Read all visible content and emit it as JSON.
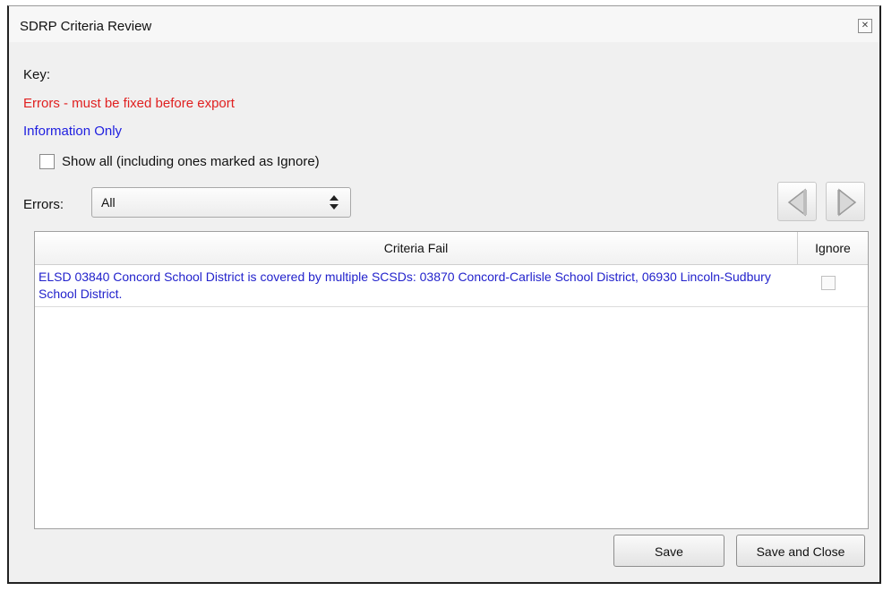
{
  "window": {
    "title": "SDRP Criteria Review",
    "close_icon": "close-icon"
  },
  "key": {
    "label": "Key:",
    "errors_text": "Errors - must be fixed before export",
    "errors_color": "#e02020",
    "info_text": "Information Only",
    "info_color": "#2020e0"
  },
  "show_all": {
    "label": "Show all (including ones marked as Ignore)",
    "checked": false
  },
  "errors_filter": {
    "label": "Errors:",
    "selected": "All"
  },
  "navigation": {
    "prev_icon": "arrow-left-icon",
    "next_icon": "arrow-right-icon"
  },
  "table": {
    "headers": [
      "Criteria Fail",
      "Ignore"
    ],
    "rows": [
      {
        "text": "ELSD 03840 Concord School District is covered by multiple SCSDs: 03870 Concord-Carlisle School District, 06930 Lincoln-Sudbury School District.",
        "ignore": false
      }
    ]
  },
  "buttons": {
    "save": "Save",
    "save_and_close": "Save and Close"
  }
}
